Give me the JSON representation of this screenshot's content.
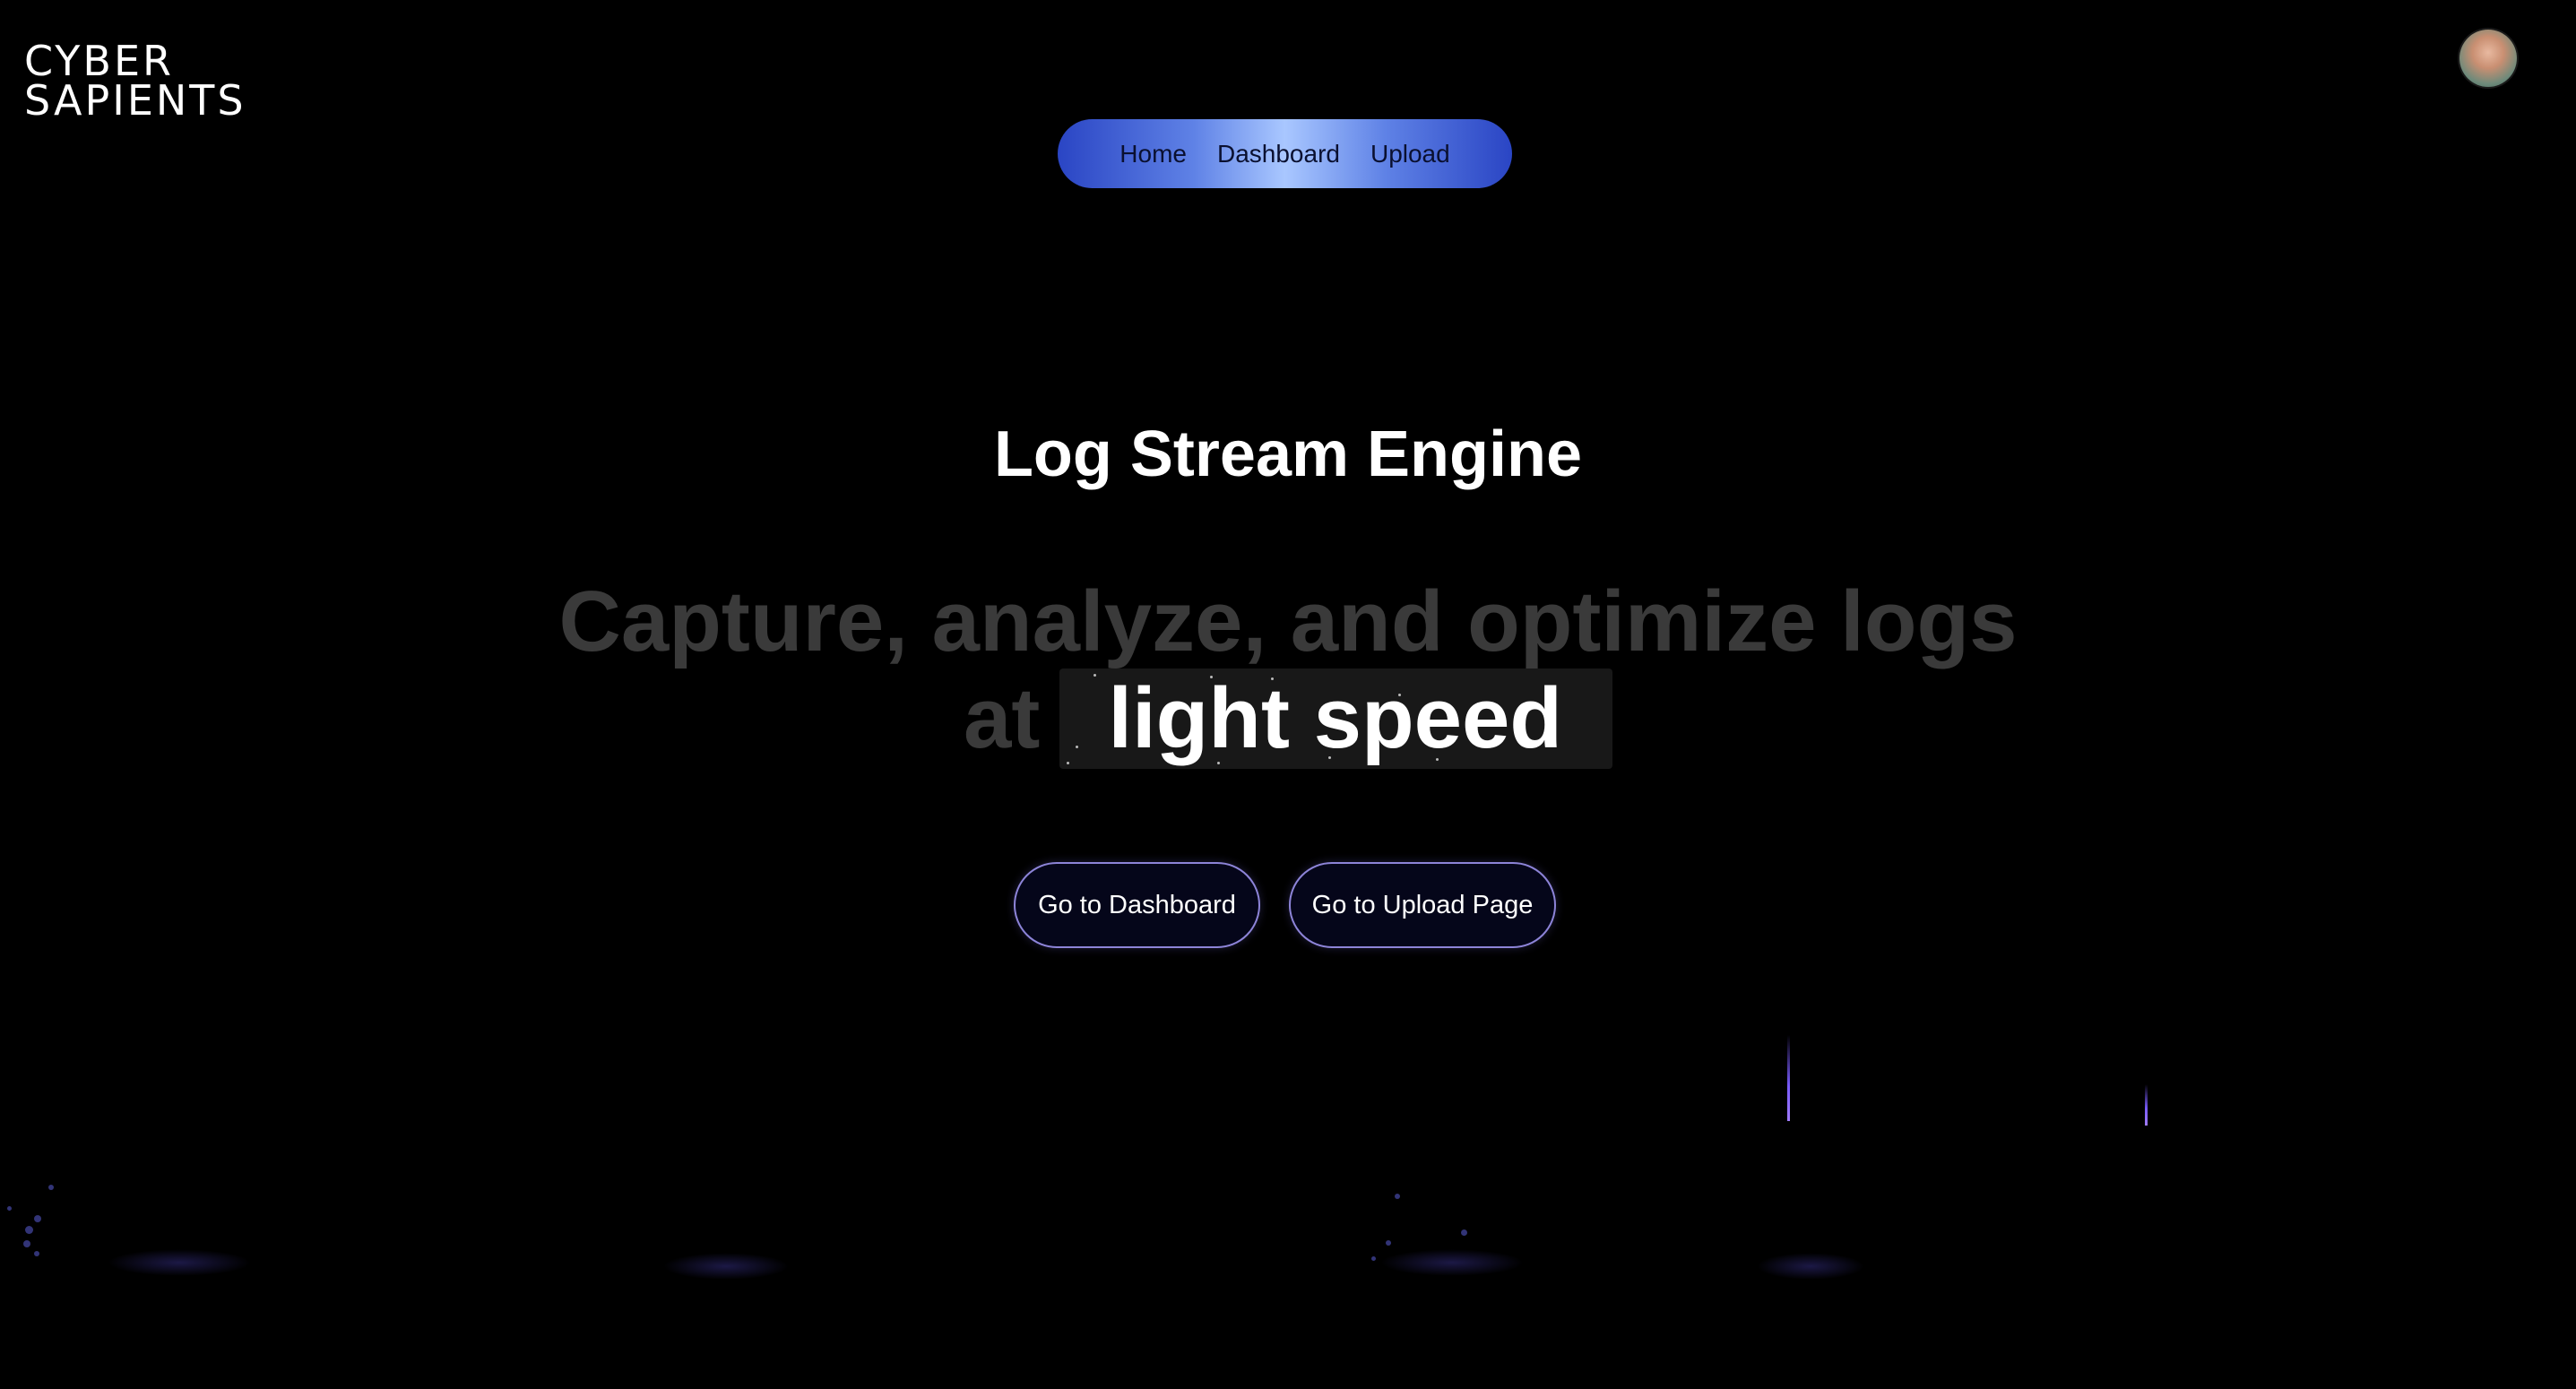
{
  "logo": {
    "line1": "CYBER",
    "line2": "SAPIENTS"
  },
  "nav": {
    "items": [
      {
        "label": "Home"
      },
      {
        "label": "Dashboard"
      },
      {
        "label": "Upload"
      }
    ]
  },
  "hero": {
    "title": "Log Stream Engine",
    "tagline_line1": "Capture, analyze, and optimize logs",
    "tagline_prefix": "at",
    "tagline_highlight": "light speed"
  },
  "actions": {
    "dashboard_label": "Go to Dashboard",
    "upload_label": "Go to Upload Page"
  },
  "colors": {
    "background": "#000000",
    "accent": "#8d84d8",
    "nav_gradient_center": "#a9c7ff",
    "nav_gradient_edge": "#2a45c4",
    "tagline_muted": "#3a3a3a"
  }
}
